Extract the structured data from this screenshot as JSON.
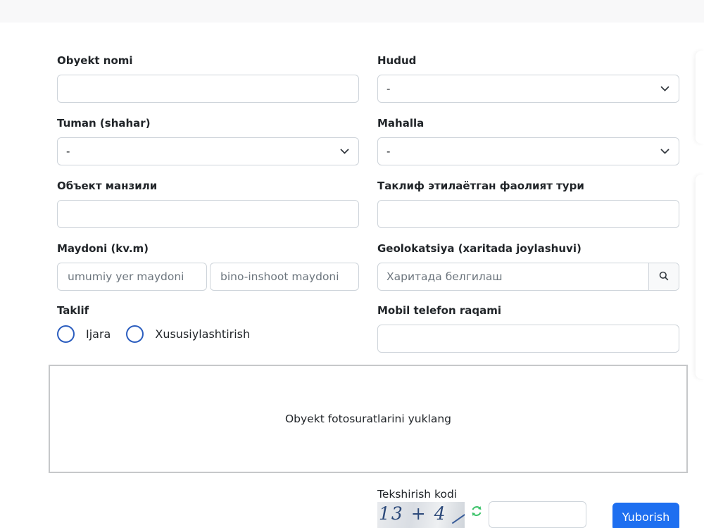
{
  "form": {
    "object_name_label": "Obyekt nomi",
    "region_label": "Hudud",
    "region_value": "-",
    "district_label": "Tuman (shahar)",
    "district_value": "-",
    "mahalla_label": "Mahalla",
    "mahalla_value": "-",
    "object_address_label": "Объект манзили",
    "activity_type_label": "Таклиф этилаётган фаолият тури",
    "area_label": "Maydoni (kv.m)",
    "total_area_placeholder": "umumiy yer maydoni",
    "building_area_placeholder": "bino-inshoot maydoni",
    "geolocation_label": "Geolokatsiya (xaritada joylashuvi)",
    "geolocation_placeholder": "Харитада белгилаш",
    "offer_label": "Taklif",
    "offer_options": [
      "Ijara",
      "Xususiylashtirish"
    ],
    "phone_label": "Mobil telefon raqami",
    "upload_text": "Obyekt fotosuratlarini yuklang",
    "captcha_label": "Tekshirish kodi",
    "captcha_text": "13 + 4 =",
    "submit_label": "Yuborish"
  },
  "colors": {
    "accent": "#1e6ff0",
    "radio_border": "#2c5ebf",
    "input_border": "#ced4da"
  },
  "icons": {
    "dropdown": "chevron-down-icon",
    "geolocation_search": "search-icon",
    "captcha_refresh": "refresh-icon"
  }
}
